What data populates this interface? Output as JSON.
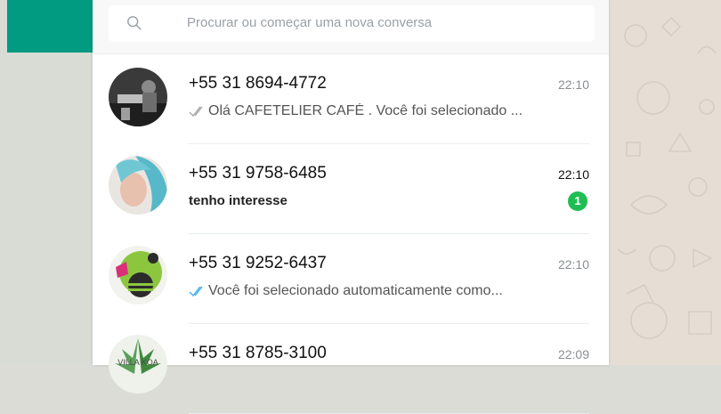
{
  "search": {
    "placeholder": "Procurar ou começar uma nova conversa"
  },
  "chats": [
    {
      "name": "+55 31 8694-4772",
      "time": "22:10",
      "preview": "Olá CAFETELIER CAFÉ . Você foi selecionado ...",
      "ticks": "read-gray",
      "unread": null
    },
    {
      "name": "+55 31 9758-6485",
      "time": "22:10",
      "preview": "tenho interesse",
      "ticks": null,
      "unread": "1"
    },
    {
      "name": "+55 31 9252-6437",
      "time": "22:10",
      "preview": "Você foi selecionado automaticamente como...",
      "ticks": "read-blue",
      "unread": null
    },
    {
      "name": "+55 31 8785-3100",
      "time": "22:09",
      "preview": "",
      "ticks": null,
      "unread": null,
      "avatar_text": "VILLA KOA"
    }
  ],
  "colors": {
    "accent": "#009b80",
    "unread_badge": "#1fbe55",
    "read_ticks": "#4fb6ec"
  }
}
